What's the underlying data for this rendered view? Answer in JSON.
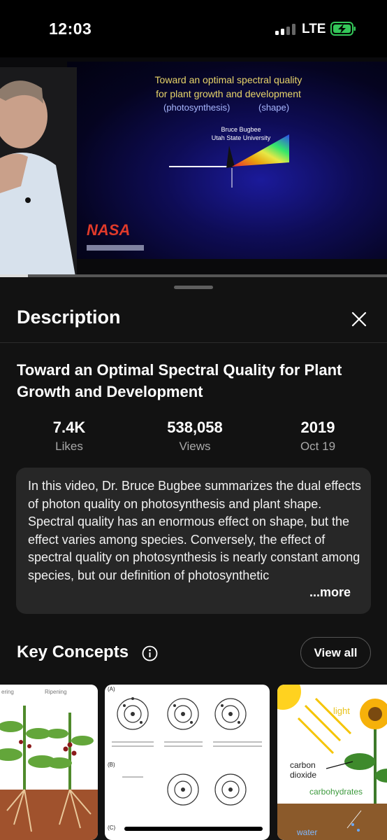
{
  "status_bar": {
    "time": "12:03",
    "network": "LTE"
  },
  "video": {
    "slide_line1": "Toward an optimal spectral quality",
    "slide_line2": "for plant growth and development",
    "slide_photosynthesis": "(photosynthesis)",
    "slide_shape": "(shape)",
    "slide_author": "Bruce Bugbee",
    "slide_university": "Utah State University",
    "logo_text": "NASA"
  },
  "sheet": {
    "header": "Description",
    "title": "Toward an Optimal Spectral Quality for Plant Growth and Development",
    "stats": [
      {
        "value": "7.4K",
        "label": "Likes"
      },
      {
        "value": "538,058",
        "label": "Views"
      },
      {
        "value": "2019",
        "label": "Oct 19"
      }
    ],
    "description": "In this video, Dr. Bruce Bugbee summarizes the dual effects of photon quality on photosynthesis and plant shape.  Spectral quality has an enormous effect on shape, but the effect varies among species.  Conversely, the effect of spectral quality on photosynthesis is nearly constant among species, but our definition of photosynthetic",
    "more_label": "...more",
    "key_concepts_title": "Key Concepts",
    "view_all_label": "View all"
  },
  "cards": {
    "card1": {
      "label_a": "ering",
      "label_b": "Ripening"
    },
    "card2": {
      "label_a": "(A)",
      "label_b": "(B)",
      "label_c": "(C)"
    },
    "card3": {
      "label_light": "light",
      "label_carbon": "carbon",
      "label_dioxide": "dioxide",
      "label_carbohydrates": "carbohydrates",
      "label_water": "water"
    }
  },
  "colors": {
    "background": "#0f0f0f",
    "description_box": "#272727",
    "battery": "#34c759"
  }
}
